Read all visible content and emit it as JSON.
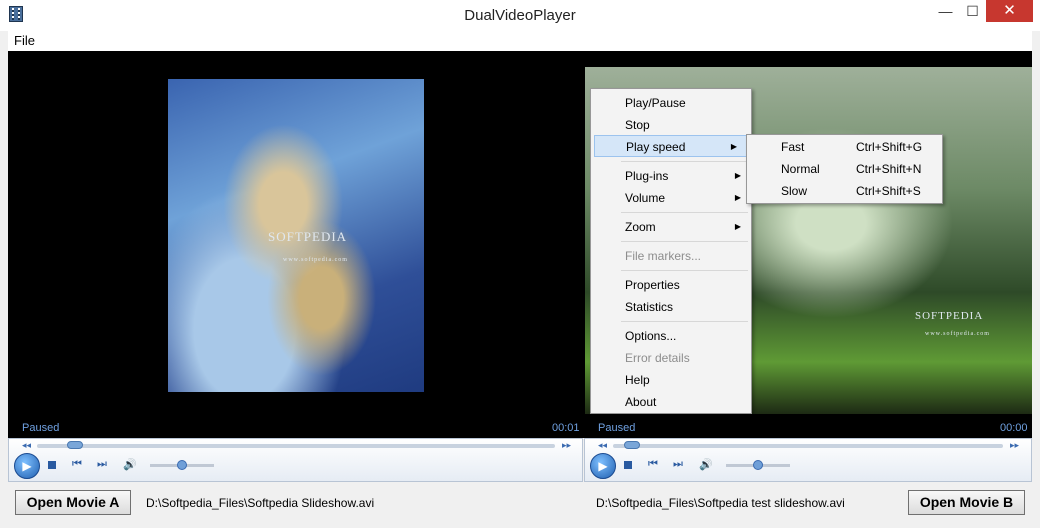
{
  "window": {
    "title": "DualVideoPlayer",
    "minimize_glyph": "—",
    "maximize_glyph": "☐",
    "close_glyph": "✕"
  },
  "menu": {
    "file": "File"
  },
  "player_a": {
    "status": "Paused",
    "time": "00:01",
    "watermark": "SOFTPEDIA",
    "watermark_url": "www.softpedia.com",
    "open_button": "Open Movie A",
    "file_path": "D:\\Softpedia_Files\\Softpedia Slideshow.avi",
    "seek_progress": 0.06,
    "volume": 0.5
  },
  "player_b": {
    "status": "Paused",
    "time": "00:00",
    "watermark": "SOFTPEDIA",
    "watermark_url": "www.softpedia.com",
    "open_button": "Open Movie B",
    "file_path": "D:\\Softpedia_Files\\Softpedia test slideshow.avi",
    "seek_progress": 0.03,
    "volume": 0.5
  },
  "context_menu": {
    "items": [
      {
        "label": "Play/Pause"
      },
      {
        "label": "Stop"
      },
      {
        "label": "Play speed"
      },
      {
        "label": "Plug-ins"
      },
      {
        "label": "Volume"
      },
      {
        "label": "Zoom"
      },
      {
        "label": "File markers..."
      },
      {
        "label": "Properties"
      },
      {
        "label": "Statistics"
      },
      {
        "label": "Options..."
      },
      {
        "label": "Error details"
      },
      {
        "label": "Help"
      },
      {
        "label": "About"
      }
    ],
    "submenu_arrow": "▶",
    "play_speed_submenu": [
      {
        "label": "Fast",
        "shortcut": "Ctrl+Shift+G"
      },
      {
        "label": "Normal",
        "shortcut": "Ctrl+Shift+N"
      },
      {
        "label": "Slow",
        "shortcut": "Ctrl+Shift+S"
      }
    ]
  },
  "icons": {
    "play": "▶",
    "prev": "⏮",
    "next": "⏭",
    "volume": "🔊",
    "rewind": "◂◂",
    "forward": "▸▸"
  },
  "colors": {
    "status_text": "#6fa0e0",
    "highlight": "#d5e6f8",
    "close_button": "#c7372f"
  }
}
